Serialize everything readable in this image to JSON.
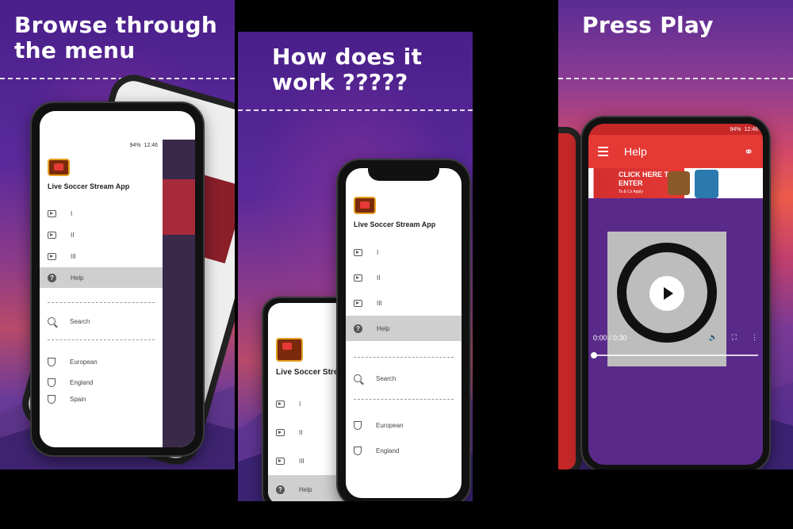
{
  "panels": {
    "left": {
      "headline_line1": "Browse through",
      "headline_line2": "the menu"
    },
    "middle": {
      "headline_line1": "How does it",
      "headline_line2": "work ?????"
    },
    "right": {
      "headline": "Press Play"
    }
  },
  "status": {
    "battery": "94%",
    "time": "12:46"
  },
  "app": {
    "name": "Live Soccer Stream App",
    "name_short": "Live Soccer Strea"
  },
  "menu": {
    "items": [
      {
        "label": "I"
      },
      {
        "label": "II"
      },
      {
        "label": "III"
      },
      {
        "label": "Help"
      },
      {
        "label": "Search"
      },
      {
        "label": "European"
      },
      {
        "label": "England"
      },
      {
        "label": "Spain"
      }
    ]
  },
  "help_screen": {
    "toolbar_title": "Help",
    "ad_text": "CLICK HERE TO ENTER",
    "ad_subtext": "Ts & Cs Apply",
    "video_time": "0:00 / 0:30",
    "progress": 0
  },
  "colors": {
    "toolbar_red": "#e53935",
    "status_red": "#c62828"
  },
  "icons": [
    "play-circle-icon",
    "help-icon",
    "search-icon",
    "trophy-icon",
    "hamburger-icon",
    "share-icon",
    "play-icon",
    "volume-icon",
    "fullscreen-icon",
    "more-vert-icon"
  ]
}
